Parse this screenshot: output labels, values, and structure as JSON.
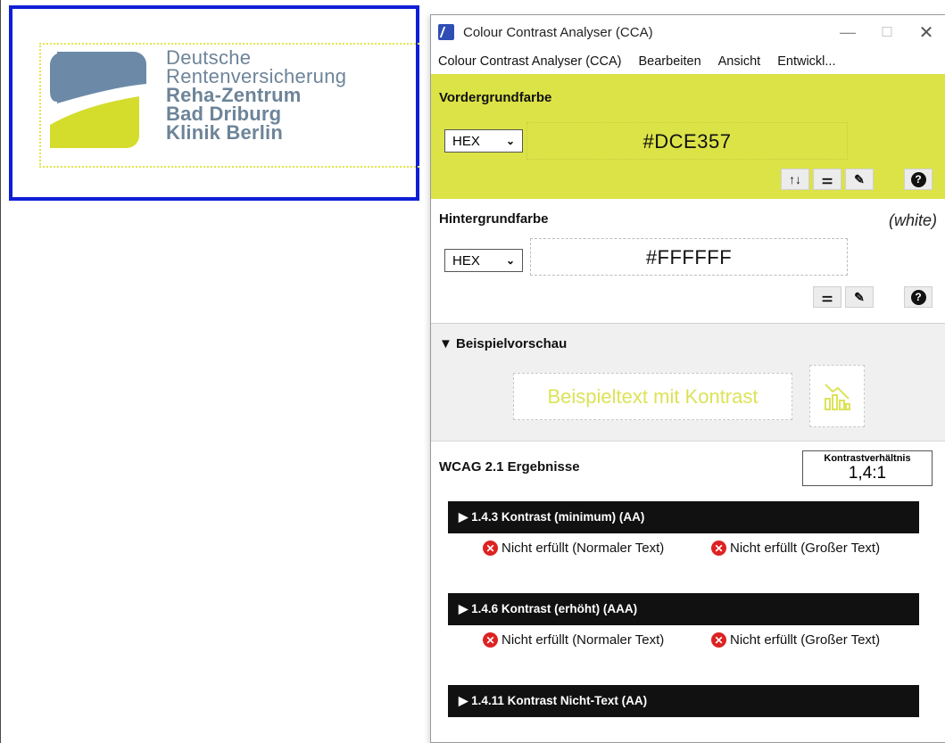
{
  "logo": {
    "line1": "Deutsche",
    "line2": "Rentenversicherung",
    "line3": "Reha-Zentrum",
    "line4": "Bad Driburg",
    "line5": "Klinik Berlin"
  },
  "window": {
    "title": "Colour Contrast Analyser (CCA)",
    "min": "—",
    "max": "☐",
    "close": "✕"
  },
  "menu": [
    "Colour Contrast Analyser (CCA)",
    "Bearbeiten",
    "Ansicht",
    "Entwickl..."
  ],
  "foreground": {
    "title": "Vordergrundfarbe",
    "format": "HEX",
    "value": "#DCE357",
    "color": "#dce347"
  },
  "background": {
    "title": "Hintergrundfarbe",
    "name": "(white)",
    "format": "HEX",
    "value": "#FFFFFF"
  },
  "preview": {
    "title": "▼ Beispielvorschau",
    "sample_text": "Beispieltext mit Kontrast"
  },
  "results": {
    "title": "WCAG 2.1 Ergebnisse",
    "ratio_label": "Kontrastverhältnis",
    "ratio_value": "1,4:1",
    "criteria": [
      {
        "label": "▶  1.4.3 Kontrast (minimum) (AA)",
        "normal": "Nicht erfüllt (Normaler Text)",
        "large": "Nicht erfüllt (Großer Text)"
      },
      {
        "label": "▶  1.4.6 Kontrast (erhöht) (AAA)",
        "normal": "Nicht erfüllt (Normaler Text)",
        "large": "Nicht erfüllt (Großer Text)"
      },
      {
        "label": "▶  1.4.11 Kontrast Nicht-Text (AA)"
      }
    ]
  }
}
